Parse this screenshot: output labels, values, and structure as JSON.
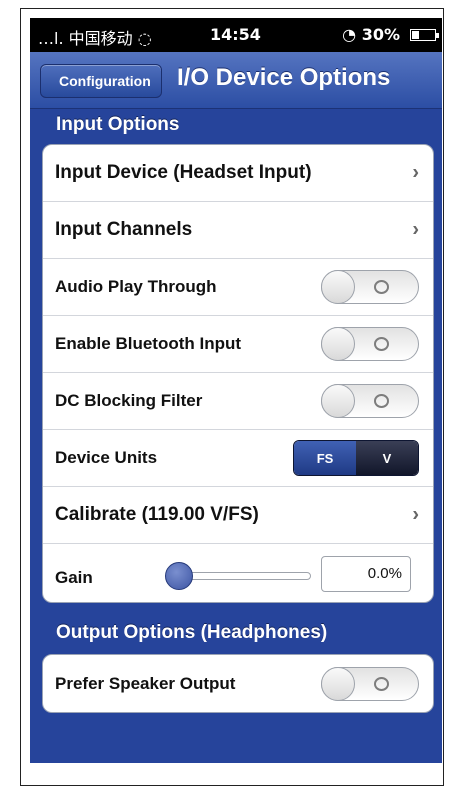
{
  "status_bar": {
    "carrier": "…l. 中国移动 ◌",
    "time": "14:54",
    "battery_text": "◔ 30%",
    "battery_level": 0.3
  },
  "nav": {
    "back_label": "Configuration",
    "title": "I/O Device Options"
  },
  "input_options": {
    "section_title": "Input Options",
    "input_device": {
      "label": "Input Device (Headset Input)",
      "chevron": "›"
    },
    "input_channels": {
      "label": "Input Channels",
      "chevron": "›"
    },
    "audio_play_through": {
      "label": "Audio Play Through",
      "on": false
    },
    "enable_bluetooth": {
      "label": "Enable Bluetooth Input",
      "on": false
    },
    "dc_blocking": {
      "label": "DC Blocking Filter",
      "on": false
    },
    "device_units": {
      "label": "Device Units",
      "options": [
        "FS",
        "V"
      ],
      "selected": "FS"
    },
    "calibrate": {
      "label": "Calibrate (119.00 V/FS)",
      "chevron": "›"
    },
    "gain": {
      "label": "Gain",
      "value": "0.0%",
      "slider_fraction": 0.0
    }
  },
  "output_options": {
    "section_title": "Output Options (Headphones)",
    "prefer_speaker": {
      "label": "Prefer Speaker Output",
      "on": false
    }
  },
  "colors": {
    "background": "#26449b",
    "accent": "#3a5bb0"
  }
}
